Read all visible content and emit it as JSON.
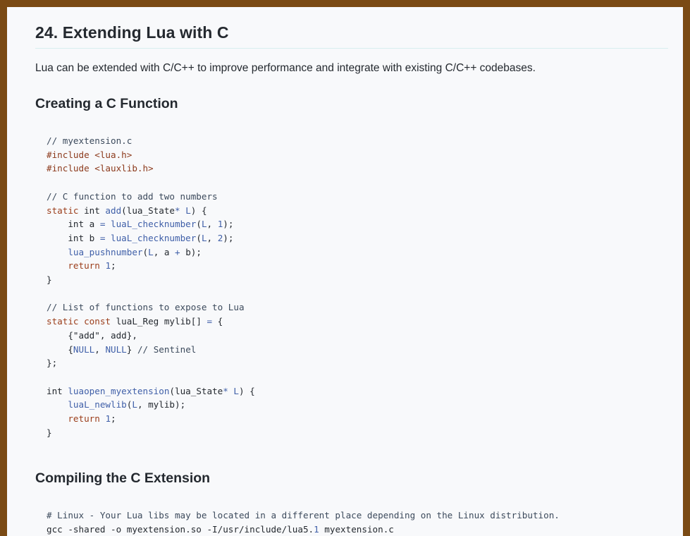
{
  "title": "24. Extending Lua with C",
  "intro": "Lua can be extended with C/C++ to improve performance and integrate with existing C/C++ codebases.",
  "sections": [
    {
      "heading": "Creating a C Function",
      "code_lines": [
        "// myextension.c",
        "#include <lua.h>",
        "#include <lauxlib.h>",
        "",
        "// C function to add two numbers",
        "static int add(lua_State* L) {",
        "    int a = luaL_checknumber(L, 1);",
        "    int b = luaL_checknumber(L, 2);",
        "    lua_pushnumber(L, a + b);",
        "    return 1;",
        "}",
        "",
        "// List of functions to expose to Lua",
        "static const luaL_Reg mylib[] = {",
        "    {\"add\", add},",
        "    {NULL, NULL} // Sentinel",
        "};",
        "",
        "int luaopen_myextension(lua_State* L) {",
        "    luaL_newlib(L, mylib);",
        "    return 1;",
        "}"
      ]
    },
    {
      "heading": "Compiling the C Extension",
      "code_lines": [
        "# Linux - Your Lua libs may be located in a different place depending on the Linux distribution.",
        "gcc -shared -o myextension.so -I/usr/include/lua5.1 myextension.c"
      ]
    }
  ]
}
